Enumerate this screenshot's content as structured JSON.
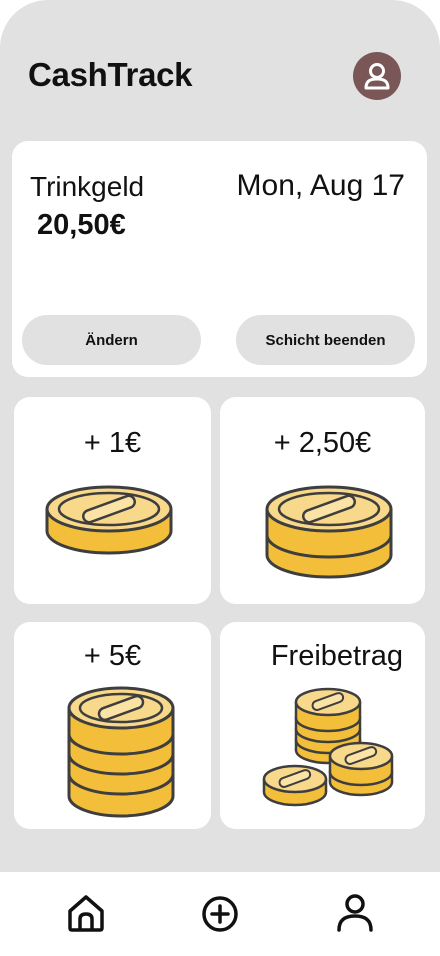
{
  "header": {
    "app_title": "CashTrack",
    "profile_icon": "user-icon"
  },
  "summary": {
    "label": "Trinkgeld",
    "amount": "20,50€",
    "date": "Mon, Aug 17",
    "change_button": "Ändern",
    "end_shift_button": "Schicht beenden"
  },
  "tiles": [
    {
      "label": "+ 1€",
      "icon": "coin-icon"
    },
    {
      "label": "+ 2,50€",
      "icon": "coin-stack-icon"
    },
    {
      "label": "+ 5€",
      "icon": "coin-stack-icon"
    },
    {
      "label": "Freibetrag",
      "icon": "coins-pile-icon"
    }
  ],
  "bottom_nav": {
    "items": [
      "home-icon",
      "add-circle-icon",
      "user-icon"
    ]
  },
  "colors": {
    "background": "#e1e1e1",
    "card": "#ffffff",
    "coin_face": "#f8d88a",
    "coin_edge": "#f3bf3b",
    "outline": "#3e3e3e",
    "avatar": "#7a5656"
  }
}
